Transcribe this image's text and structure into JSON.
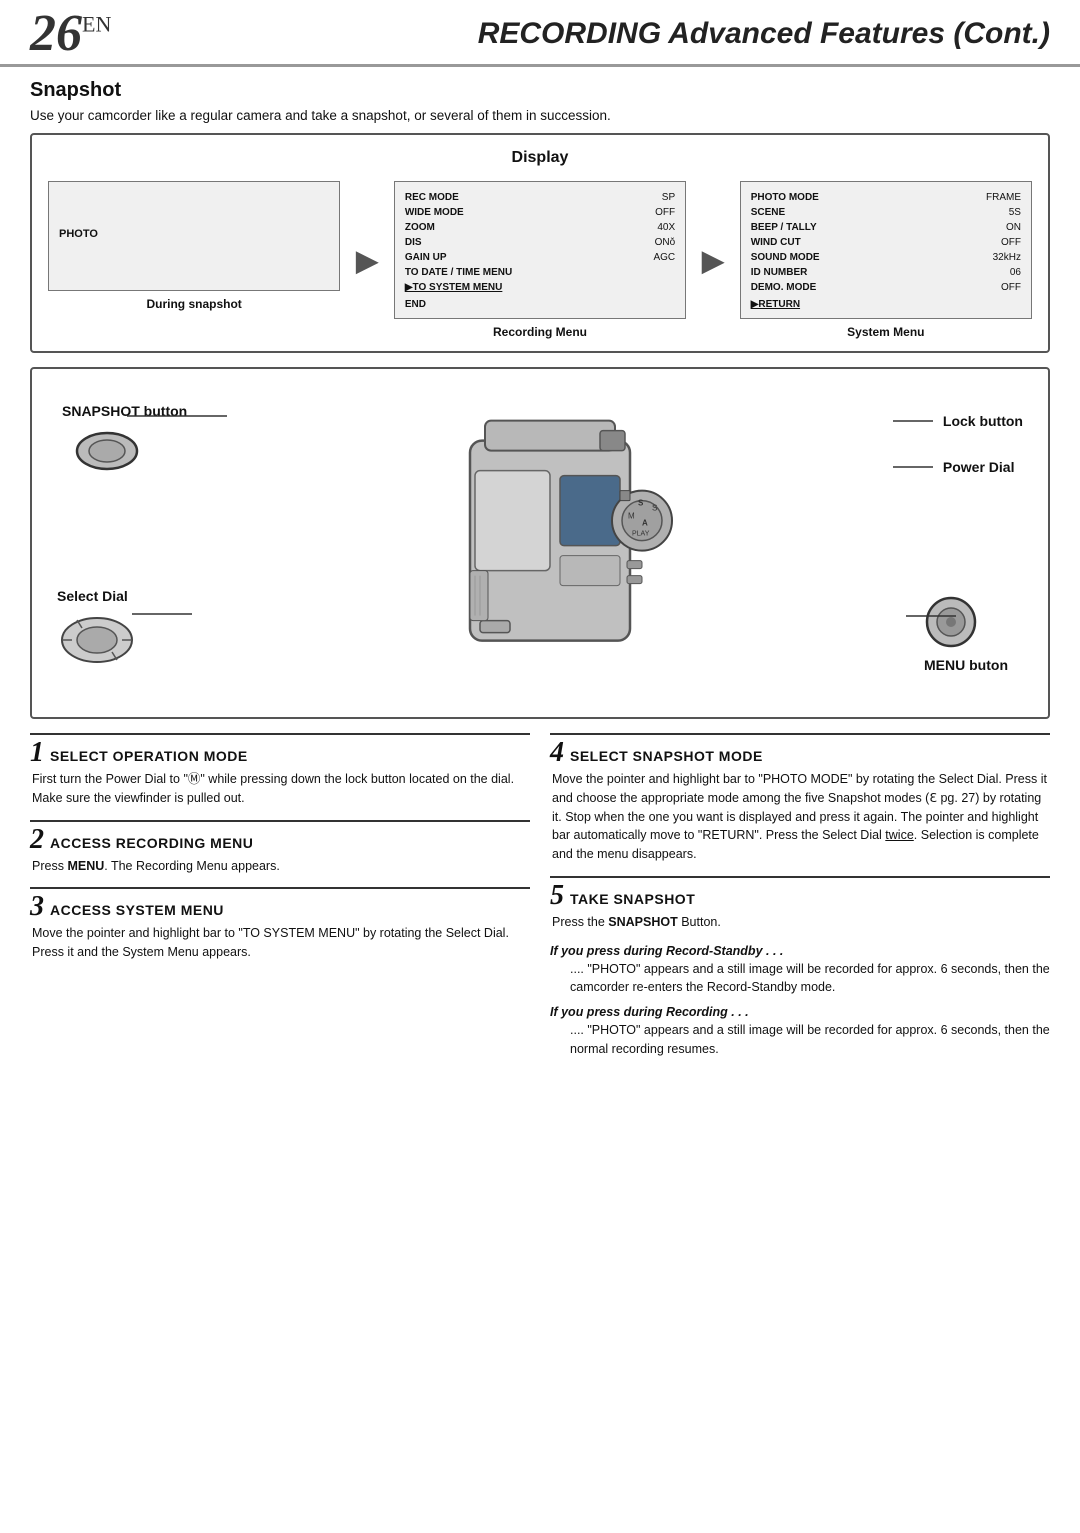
{
  "header": {
    "page_number": "26",
    "page_number_suffix": "EN",
    "title": "RECORDING Advanced Features (Cont.)"
  },
  "section": {
    "title": "Snapshot",
    "intro": "Use your camcorder like a regular camera and take a snapshot, or several of them in succession."
  },
  "display_box": {
    "title": "Display",
    "panels": [
      {
        "id": "during-snapshot",
        "label_in_box": "PHOTO",
        "caption": "During snapshot"
      },
      {
        "id": "recording-menu",
        "caption": "Recording Menu",
        "menu_items": [
          {
            "key": "REC MODE",
            "val": "SP"
          },
          {
            "key": "WIDE MODE",
            "val": "OFF"
          },
          {
            "key": "ZOOM",
            "val": "40X"
          },
          {
            "key": "DIS",
            "val": "ON"
          },
          {
            "key": "GAIN UP",
            "val": "AGC"
          },
          {
            "key": "TO DATE / TIME MENU",
            "val": "",
            "highlight": false
          },
          {
            "key": "▶TO SYSTEM MENU",
            "val": "",
            "highlight": true
          }
        ],
        "end_label": "END"
      },
      {
        "id": "system-menu",
        "caption": "System Menu",
        "menu_items": [
          {
            "key": "PHOTO MODE",
            "val": "FRAME"
          },
          {
            "key": "SCENE",
            "val": "5S"
          },
          {
            "key": "BEEP / TALLY",
            "val": "ON"
          },
          {
            "key": "WIND CUT",
            "val": "OFF"
          },
          {
            "key": "SOUND MODE",
            "val": "32kHz"
          },
          {
            "key": "ID NUMBER",
            "val": "06"
          },
          {
            "key": "DEMO. MODE",
            "val": "OFF"
          }
        ],
        "return_label": "▶RETURN"
      }
    ]
  },
  "camera_labels": {
    "snapshot_button": "SNAPSHOT button",
    "select_dial": "Select Dial",
    "lock_button": "Lock button",
    "power_dial": "Power Dial",
    "menu_button": "MENU buton"
  },
  "steps": [
    {
      "number": "1",
      "title": "SELECT OPERATION MODE",
      "body": "First turn the Power Dial to \"Ⓜ\" while pressing down the lock button located on the dial. Make sure the viewfinder is pulled out."
    },
    {
      "number": "2",
      "title": "ACCESS RECORDING MENU",
      "body": "Press MENU. The Recording Menu appears."
    },
    {
      "number": "3",
      "title": "ACCESS SYSTEM MENU",
      "body": "Move the pointer and highlight bar to \"TO SYSTEM MENU\" by rotating the Select Dial. Press it and the System Menu appears."
    },
    {
      "number": "4",
      "title": "SELECT SNAPSHOT MODE",
      "body": "Move the pointer and highlight bar to \"PHOTO MODE\" by rotating the Select Dial. Press it and choose the appropriate mode among the five Snapshot modes (ℇ pg. 27) by rotating it. Stop when the one you want is displayed and press it again. The pointer and highlight bar automatically move to \"RETURN\". Press the Select Dial twice. Selection is complete and the menu disappears."
    },
    {
      "number": "5",
      "title": "TAKE SNAPSHOT",
      "body": "Press the SNAPSHOT Button."
    }
  ],
  "notes": [
    {
      "title": "If you press during Record-Standby . . .",
      "body": ".... \"PHOTO\" appears and a still image will be recorded for approx. 6 seconds, then the camcorder re-enters the Record-Standby mode."
    },
    {
      "title": "If you press during Recording . . .",
      "body": ".... \"PHOTO\" appears and a still image will be recorded for approx. 6 seconds, then the normal recording resumes."
    }
  ]
}
